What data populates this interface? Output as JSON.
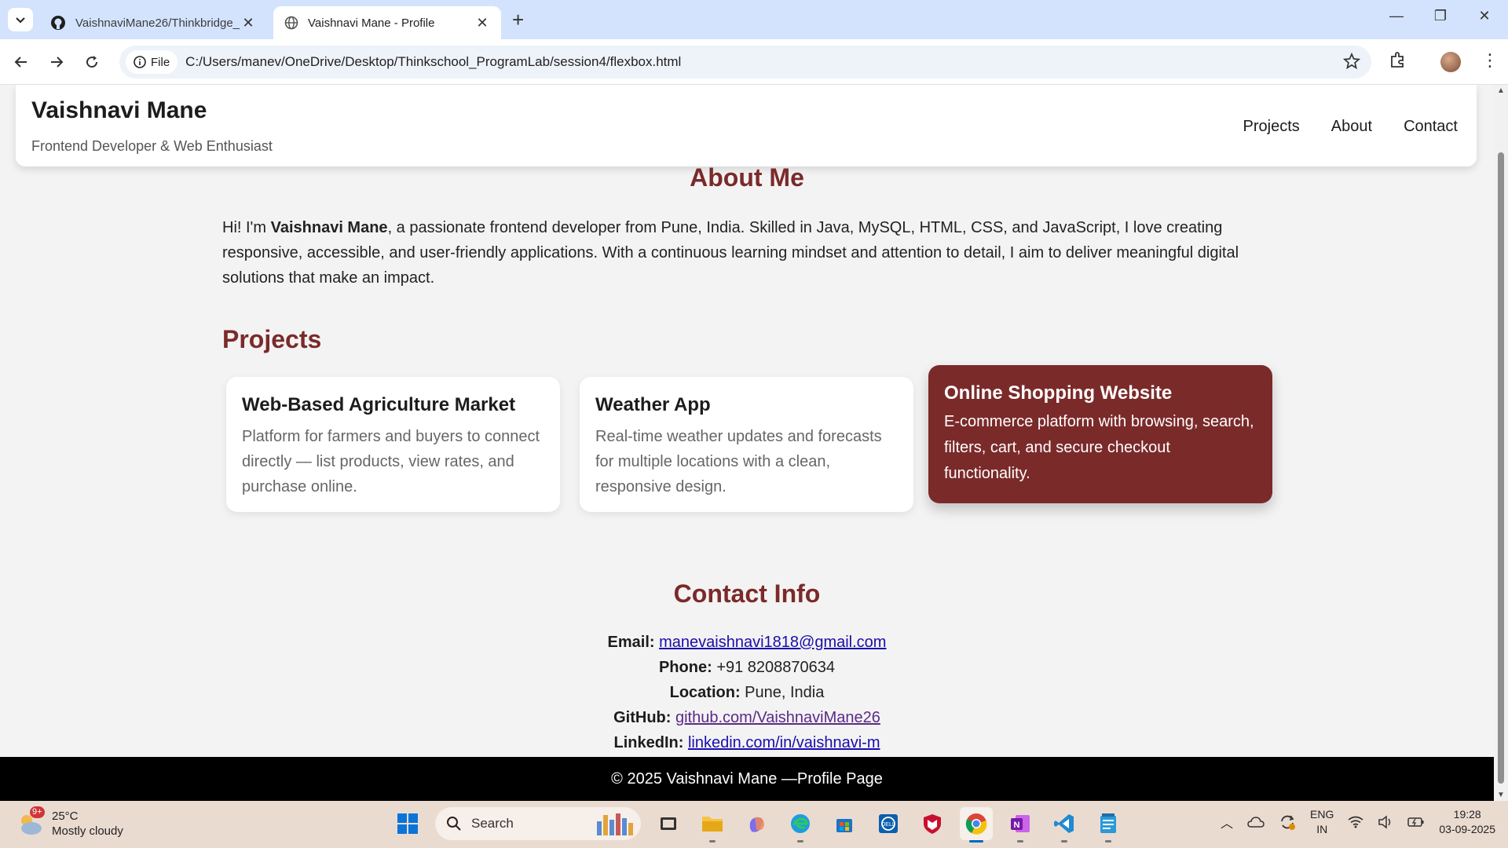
{
  "browser": {
    "tabs": [
      {
        "title": "VaishnaviMane26/Thinkbridge_",
        "active": false
      },
      {
        "title": "Vaishnavi Mane - Profile",
        "active": true
      }
    ],
    "address": {
      "chip": "File",
      "url": "C:/Users/manev/OneDrive/Desktop/Thinkschool_ProgramLab/session4/flexbox.html"
    }
  },
  "site": {
    "name": "Vaishnavi Mane",
    "tagline": "Frontend Developer & Web Enthusiast",
    "nav": [
      "Projects",
      "About",
      "Contact"
    ]
  },
  "about": {
    "title": "About Me",
    "intro": "Hi! I'm ",
    "name_bold": "Vaishnavi Mane",
    "body": ", a passionate frontend developer from Pune, India. Skilled in Java, MySQL, HTML, CSS, and JavaScript, I love creating responsive, accessible, and user-friendly applications. With a continuous learning mindset and attention to detail, I aim to deliver meaningful digital solutions that make an impact."
  },
  "projects": {
    "title": "Projects",
    "items": [
      {
        "title": "Web-Based Agriculture Market",
        "desc": "Platform for farmers and buyers to connect directly — list products, view rates, and purchase online."
      },
      {
        "title": "Weather App",
        "desc": "Real-time weather updates and forecasts for multiple locations with a clean, responsive design."
      },
      {
        "title": "Online Shopping Website",
        "desc": "E-commerce platform with browsing, search, filters, cart, and secure checkout functionality."
      }
    ]
  },
  "contact": {
    "title": "Contact Info",
    "email_label": "Email:",
    "email": "manevaishnavi1818@gmail.com",
    "phone_label": "Phone:",
    "phone": "+91 8208870634",
    "location_label": "Location:",
    "location": "Pune, India",
    "github_label": "GitHub:",
    "github": "github.com/VaishnaviMane26",
    "linkedin_label": "LinkedIn:",
    "linkedin": "linkedin.com/in/vaishnavi-m"
  },
  "footer": {
    "text": "© 2025 Vaishnavi Mane —Profile Page"
  },
  "taskbar": {
    "weather_badge": "9+",
    "temp": "25°C",
    "condition": "Mostly cloudy",
    "search_placeholder": "Search",
    "lang_1": "ENG",
    "lang_2": "IN",
    "time": "19:28",
    "date": "03-09-2025"
  },
  "colors": {
    "accent": "#7b2a2a",
    "footer_bg": "#000000",
    "tab_strip": "#d3e3fd"
  }
}
